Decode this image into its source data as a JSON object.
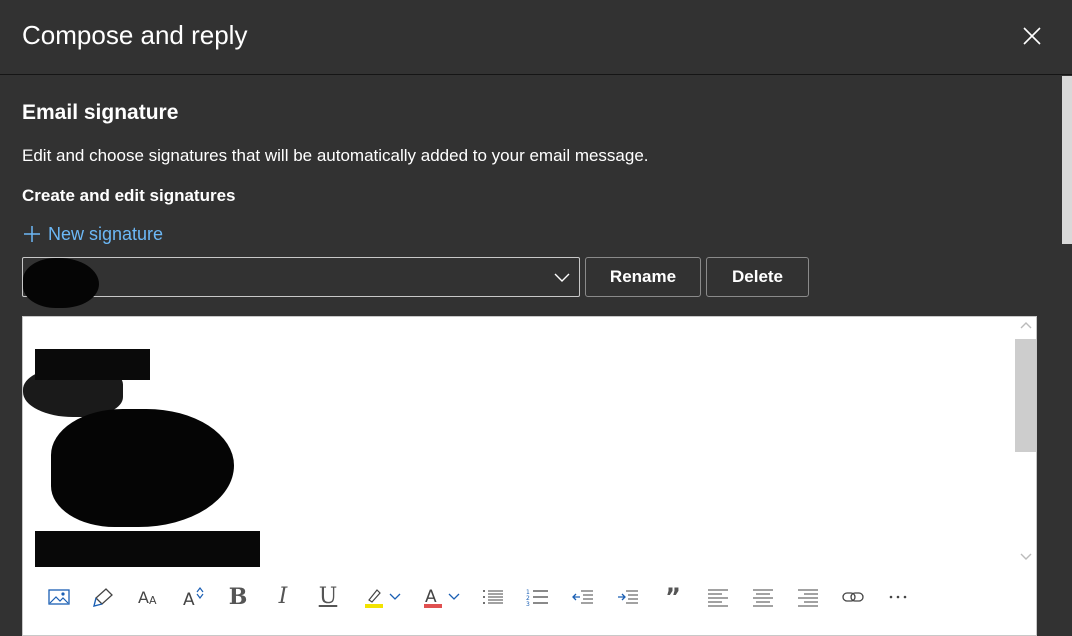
{
  "header": {
    "title": "Compose and reply"
  },
  "section": {
    "title": "Email signature",
    "description": "Edit and choose signatures that will be automatically added to your email message.",
    "subheading": "Create and edit signatures",
    "new_signature_label": "New signature"
  },
  "signature_select": {
    "selected_value": ""
  },
  "buttons": {
    "rename": "Rename",
    "delete": "Delete"
  },
  "toolbar": {
    "items": [
      "insert-picture-icon",
      "format-painter-icon",
      "font-size-icon",
      "grow-font-icon",
      "bold-icon",
      "italic-icon",
      "underline-icon",
      "highlight-icon",
      "font-color-icon",
      "bullets-icon",
      "numbering-icon",
      "decrease-indent-icon",
      "increase-indent-icon",
      "quote-icon",
      "align-left-icon",
      "align-center-icon",
      "align-right-icon",
      "link-icon",
      "more-options-icon"
    ],
    "highlight_color": "#f2e300",
    "font_color": "#e05050"
  },
  "colors": {
    "accent": "#6cb8f6",
    "background": "#323232"
  }
}
